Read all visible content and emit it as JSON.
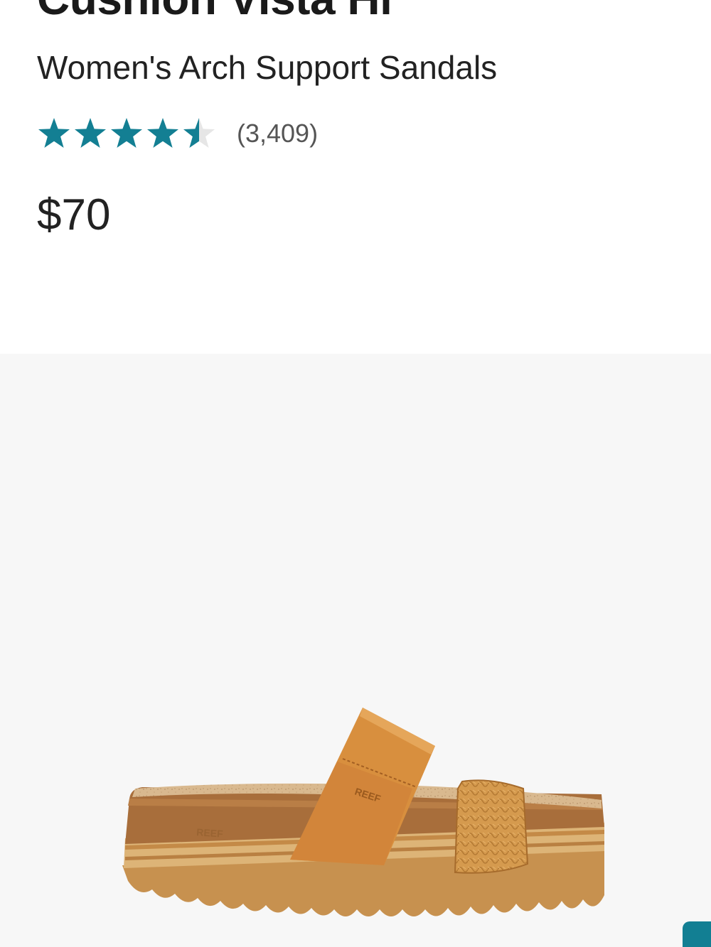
{
  "product": {
    "name": "Cushion Vista Hi",
    "subtitle": "Women's Arch Support Sandals",
    "price": "$70"
  },
  "rating": {
    "value": 4.5,
    "max": 5,
    "count_label": "(3,409)",
    "star_color": "#137f93",
    "empty_star_color": "#e6e6e6"
  },
  "image": {
    "brand_mark": "REEF",
    "background_color": "#f7f7f7"
  },
  "floating_button": {
    "color": "#127f93"
  }
}
